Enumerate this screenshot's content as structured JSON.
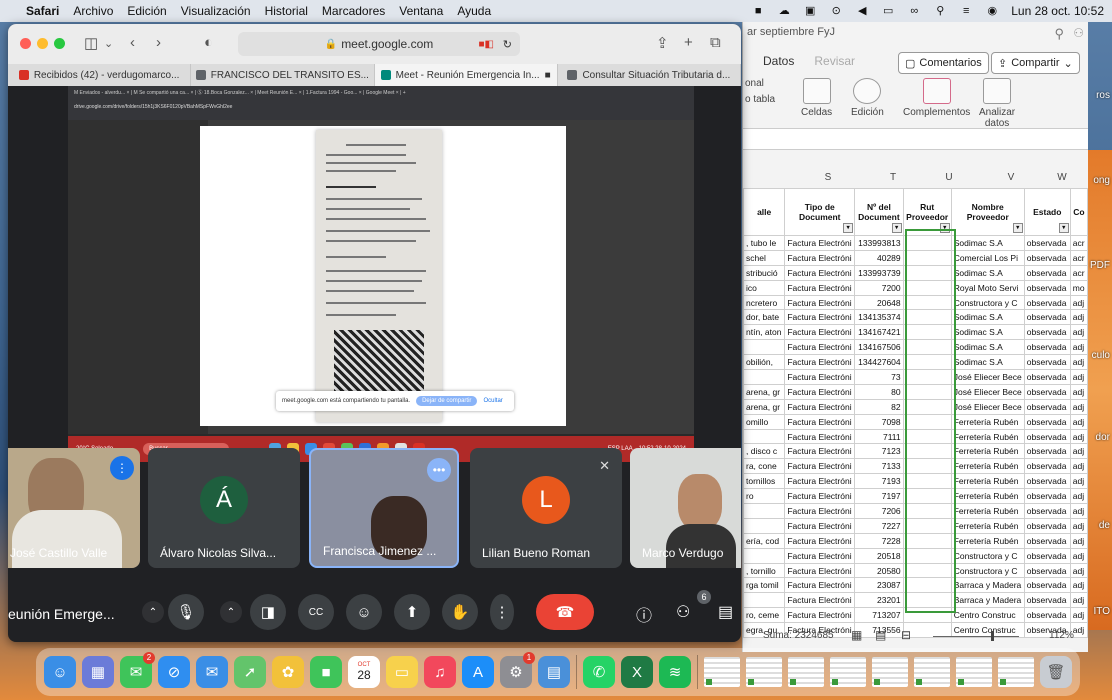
{
  "menubar": {
    "app": "Safari",
    "items": [
      "Archivo",
      "Edición",
      "Visualización",
      "Historial",
      "Marcadores",
      "Ventana",
      "Ayuda"
    ],
    "datetime": "Lun 28 oct. 10:52"
  },
  "safari": {
    "url": "meet.google.com",
    "tabs": [
      {
        "label": "Recibidos (42) - verdugomarco...",
        "color": "#d93025"
      },
      {
        "label": "FRANCISCO DEL TRANSITO ES...",
        "color": "#5f6368"
      },
      {
        "label": "Meet - Reunión Emergencia In...",
        "color": "#00897b"
      },
      {
        "label": "Consultar Situación Tributaria d...",
        "color": "#5f6368"
      }
    ]
  },
  "shared_screen": {
    "tabs_text": "M Enviados - alverdu... × | M Se compartió una ca... × | Ⓢ 18.Boca Gonzalez... × | Meet Reunión E... × | 1.Factura 1994 - Goo... × | Google Meet × | +",
    "url_text": "drive.google.com/drive/folders/15h1j3KS6F0120pVBahMSpFWvGhl2ee",
    "banner_text": "meet.google.com está compartiendo tu pantalla.",
    "banner_stop": "Dejar de compartir",
    "banner_hide": "Ocultar",
    "weather": "20°C Soleado",
    "search": "Buscar",
    "lang": "ESP LAA",
    "clock": "10:52 28-10-2024"
  },
  "participants": [
    {
      "name": "José Castillo Valle",
      "type": "video"
    },
    {
      "name": "Álvaro Nicolas Silva...",
      "initial": "Á",
      "color": "#1e5f3e"
    },
    {
      "name": "Francisca Jimenez ...",
      "type": "video"
    },
    {
      "name": "Lilian Bueno Roman",
      "initial": "L",
      "color": "#e8581c"
    },
    {
      "name": "Marco Verdugo",
      "type": "video"
    }
  ],
  "meeting": {
    "title": "eunión Emerge...",
    "participant_count": "6"
  },
  "excel": {
    "title": "ar septiembre FyJ",
    "menu": [
      "Datos",
      "Revisar"
    ],
    "comments_label": "Comentarios",
    "share_label": "Compartir",
    "ribbon": {
      "left1": "onal",
      "left2": "o tabla",
      "cells": "Celdas",
      "edit": "Edición",
      "complements": "Complementos",
      "analyze1": "Analizar",
      "analyze2": "datos"
    },
    "columns": [
      "S",
      "T",
      "U",
      "V",
      "W"
    ],
    "headers": [
      "alle",
      "Tipo de Document",
      "Nº del Document",
      "Rut Proveedor",
      "Nombre Proveedor",
      "Estado",
      "Co"
    ],
    "rows": [
      [
        ", tubo le",
        "Factura Electróni",
        "133993813",
        "",
        "Sodimac S.A",
        "observada",
        "acr"
      ],
      [
        "schel",
        "Factura Electróni",
        "40289",
        "",
        "Comercial Los Pi",
        "observada",
        "acr"
      ],
      [
        "stribució",
        "Factura Electróni",
        "133993739",
        "",
        "Sodimac S.A",
        "observada",
        "acr"
      ],
      [
        "ico",
        "Factura Electróni",
        "7200",
        "",
        "Royal Moto Servi",
        "observada",
        "mo"
      ],
      [
        "ncretero",
        "Factura Electróni",
        "20648",
        "",
        "Constructora y C",
        "observada",
        "adj"
      ],
      [
        "dor, bate",
        "Factura Electróni",
        "134135374",
        "",
        "Sodimac S.A",
        "observada",
        "adj"
      ],
      [
        "ntín, aton",
        "Factura Electróni",
        "134167421",
        "",
        "Sodimac S.A",
        "observada",
        "adj"
      ],
      [
        "",
        "Factura Electróni",
        "134167506",
        "",
        "Sodimac S.A",
        "observada",
        "adj"
      ],
      [
        "obilión,",
        "Factura Electróni",
        "134427604",
        "",
        "Sodimac S.A",
        "observada",
        "adj"
      ],
      [
        "",
        "Factura Electróni",
        "73",
        "",
        "José Eliecer Bece",
        "observada",
        "adj"
      ],
      [
        "arena, gr",
        "Factura Electróni",
        "80",
        "",
        "José Eliecer Bece",
        "observada",
        "adj"
      ],
      [
        "arena, gr",
        "Factura Electróni",
        "82",
        "",
        "José Eliecer Bece",
        "observada",
        "adj"
      ],
      [
        "omillo",
        "Factura Electróni",
        "7098",
        "",
        "Ferretería Rubén",
        "observada",
        "adj"
      ],
      [
        "",
        "Factura Electróni",
        "7111",
        "",
        "Ferretería Rubén",
        "observada",
        "adj"
      ],
      [
        ", disco c",
        "Factura Electróni",
        "7123",
        "",
        "Ferretería Rubén",
        "observada",
        "adj"
      ],
      [
        "ra, cone",
        "Factura Electróni",
        "7133",
        "",
        "Ferretería Rubén",
        "observada",
        "adj"
      ],
      [
        "tornillos",
        "Factura Electróni",
        "7193",
        "",
        "Ferretería Rubén",
        "observada",
        "adj"
      ],
      [
        "ro",
        "Factura Electróni",
        "7197",
        "",
        "Ferretería Rubén",
        "observada",
        "adj"
      ],
      [
        "",
        "Factura Electróni",
        "7206",
        "",
        "Ferretería Rubén",
        "observada",
        "adj"
      ],
      [
        "",
        "Factura Electróni",
        "7227",
        "",
        "Ferretería Rubén",
        "observada",
        "adj"
      ],
      [
        "ería, cod",
        "Factura Electróni",
        "7228",
        "",
        "Ferretería Rubén",
        "observada",
        "adj"
      ],
      [
        "",
        "Factura Electróni",
        "20518",
        "",
        "Constructora y C",
        "observada",
        "adj"
      ],
      [
        ", tornillo",
        "Factura Electróni",
        "20580",
        "",
        "Constructora y C",
        "observada",
        "adj"
      ],
      [
        "rga tomil",
        "Factura Electróni",
        "23087",
        "",
        "Barraca y Madera",
        "observada",
        "adj"
      ],
      [
        "",
        "Factura Electróni",
        "23201",
        "",
        "Barraca y Madera",
        "observada",
        "adj"
      ],
      [
        "ro, ceme",
        "Factura Electróni",
        "713207",
        "",
        "Centro Construc",
        "observada",
        "adj"
      ],
      [
        "egra, gu",
        "Factura Electróni",
        "713556",
        "",
        "Centro Construc",
        "observada",
        "adj"
      ]
    ],
    "sum": "Suma: 2324685",
    "zoom": "112%"
  },
  "wallpaper_labels": [
    "ong",
    "PDF",
    "culo",
    "dor",
    "de",
    "ITO",
    "ros"
  ],
  "dock": {
    "apps": [
      {
        "name": "finder",
        "color": "#3a8ee6",
        "glyph": "☺"
      },
      {
        "name": "launchpad",
        "color": "#6b7bd8",
        "glyph": "▦"
      },
      {
        "name": "messages",
        "color": "#3fc45a",
        "glyph": "✉",
        "badge": "2"
      },
      {
        "name": "safari",
        "color": "#2f8ef0",
        "glyph": "⊘"
      },
      {
        "name": "mail",
        "color": "#3a8ee6",
        "glyph": "✉"
      },
      {
        "name": "maps",
        "color": "#63c46b",
        "glyph": "➚"
      },
      {
        "name": "photos",
        "color": "#f2c13a",
        "glyph": "✿"
      },
      {
        "name": "facetime",
        "color": "#3fc45a",
        "glyph": "■"
      },
      {
        "name": "calendar",
        "color": "#ffffff",
        "glyph": "28",
        "month": "OCT"
      },
      {
        "name": "notes",
        "color": "#f7d14c",
        "glyph": "▭"
      },
      {
        "name": "music",
        "color": "#f2485c",
        "glyph": "♫"
      },
      {
        "name": "app-store",
        "color": "#1c8ef9",
        "glyph": "A"
      },
      {
        "name": "settings",
        "color": "#8e8e93",
        "glyph": "⚙",
        "badge": "1"
      },
      {
        "name": "preview",
        "color": "#4a90d9",
        "glyph": "▤"
      },
      {
        "name": "whatsapp",
        "color": "#25d366",
        "glyph": "✆"
      },
      {
        "name": "excel",
        "color": "#1f7a44",
        "glyph": "X"
      },
      {
        "name": "spotify",
        "color": "#1db954",
        "glyph": "≋"
      }
    ],
    "trash_glyph": "🗑"
  }
}
